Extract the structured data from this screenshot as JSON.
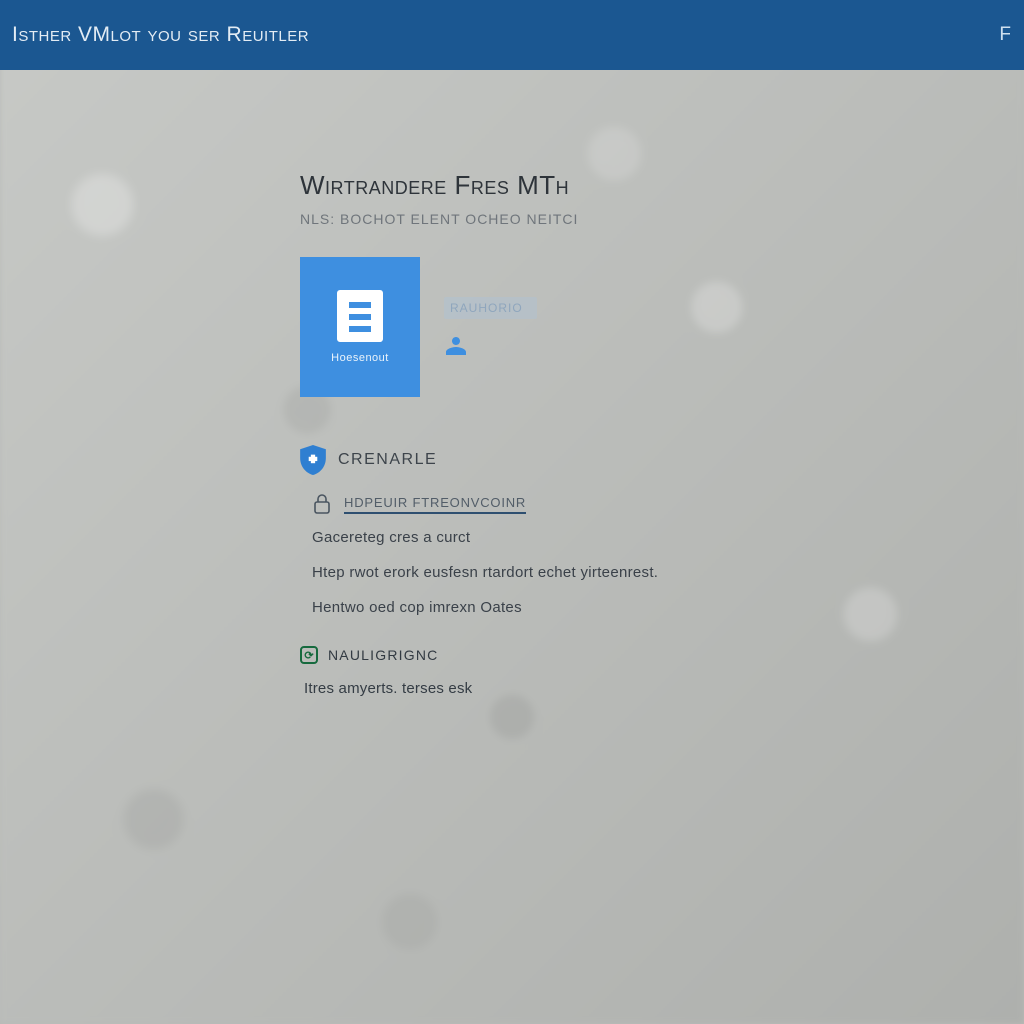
{
  "header": {
    "title": "Isther VMlot you ser Reuitler",
    "right": "F"
  },
  "main": {
    "title": "Wirtrandere Fres MTh",
    "subtitle": "NLS: BOCHOT ELENT OCHEO NEITCI"
  },
  "tile": {
    "caption": "Hoesenout",
    "side_label": "RAUHORIO",
    "person_icon_name": "person-icon"
  },
  "section1": {
    "title": "CRENARLE",
    "shield_icon_name": "shield-icon",
    "subrow": {
      "icon_name": "lock-icon",
      "label": "HDPEUIR FTREONVCOINR"
    },
    "paras": [
      "Gacereteg cres a curct",
      "Htep rwot erork eusfesn rtardort echet yirteenrest.",
      "Hentwo oed cop imrexn Oates"
    ]
  },
  "section2": {
    "title": "NAULIGRIGNC",
    "icon_name": "refresh-icon",
    "body": "Itres amyerts. terses esk"
  }
}
